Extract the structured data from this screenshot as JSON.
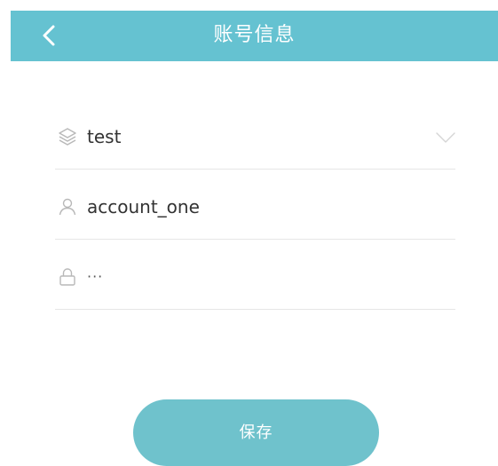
{
  "header": {
    "title": "账号信息",
    "back_icon": "chevron-left-icon"
  },
  "form": {
    "server": {
      "icon": "layers-icon",
      "value": "test",
      "dropdown_icon": "chevron-down-icon"
    },
    "account": {
      "icon": "user-icon",
      "value": "account_one"
    },
    "password": {
      "icon": "lock-icon",
      "value": "···"
    }
  },
  "actions": {
    "save_label": "保存"
  },
  "colors": {
    "header_bg": "#65c2d1",
    "button_bg": "#6fc2cc",
    "icon": "#b5b5b5",
    "divider": "#e6e6e6"
  }
}
